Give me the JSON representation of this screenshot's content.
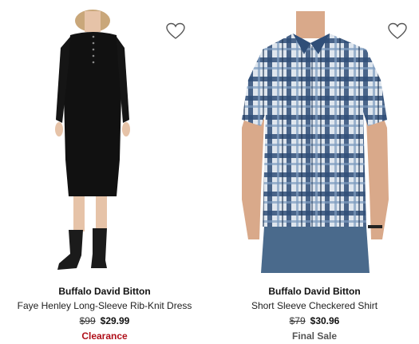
{
  "products": [
    {
      "brand": "Buffalo David Bitton",
      "title": "Faye Henley Long-Sleeve Rib-Knit Dress",
      "original_price": "$99",
      "sale_price": "$29.99",
      "tag": "Clearance",
      "wishlist_icon": "heart-outline-icon"
    },
    {
      "brand": "Buffalo David Bitton",
      "title": "Short Sleeve Checkered Shirt",
      "original_price": "$79",
      "sale_price": "$30.96",
      "tag": "Final Sale",
      "wishlist_icon": "heart-outline-icon"
    }
  ],
  "colors": {
    "clearance": "#b0101a",
    "final_sale": "#555555",
    "text": "#111111"
  }
}
